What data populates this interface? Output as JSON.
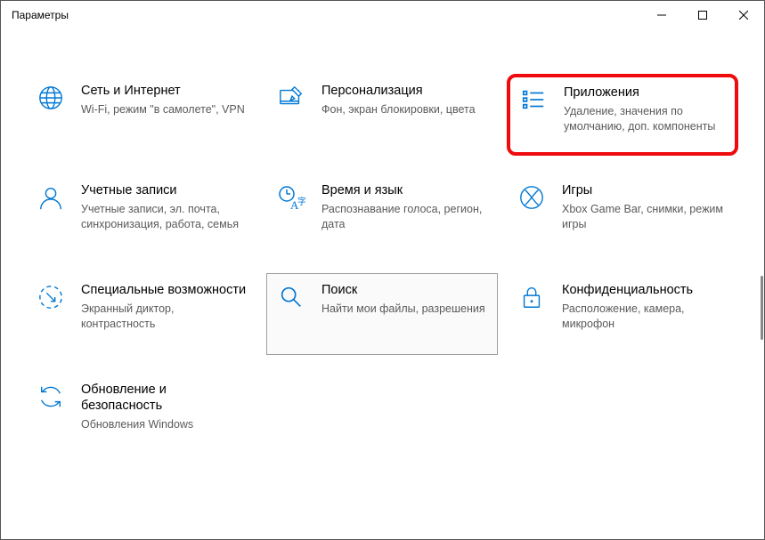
{
  "window": {
    "title": "Параметры"
  },
  "tiles": [
    {
      "title": "Сеть и Интернет",
      "sub": "Wi-Fi, режим \"в самолете\", VPN"
    },
    {
      "title": "Персонализация",
      "sub": "Фон, экран блокировки, цвета"
    },
    {
      "title": "Приложения",
      "sub": "Удаление, значения по умолчанию, доп. компоненты"
    },
    {
      "title": "Учетные записи",
      "sub": "Учетные записи, эл. почта, синхронизация, работа, семья"
    },
    {
      "title": "Время и язык",
      "sub": "Распознавание голоса, регион, дата"
    },
    {
      "title": "Игры",
      "sub": "Xbox Game Bar, снимки, режим игры"
    },
    {
      "title": "Специальные возможности",
      "sub": "Экранный диктор, контрастность"
    },
    {
      "title": "Поиск",
      "sub": "Найти мои файлы, разрешения"
    },
    {
      "title": "Конфиденциальность",
      "sub": "Расположение, камера, микрофон"
    },
    {
      "title": "Обновление и безопасность",
      "sub": "Обновления Windows"
    }
  ]
}
